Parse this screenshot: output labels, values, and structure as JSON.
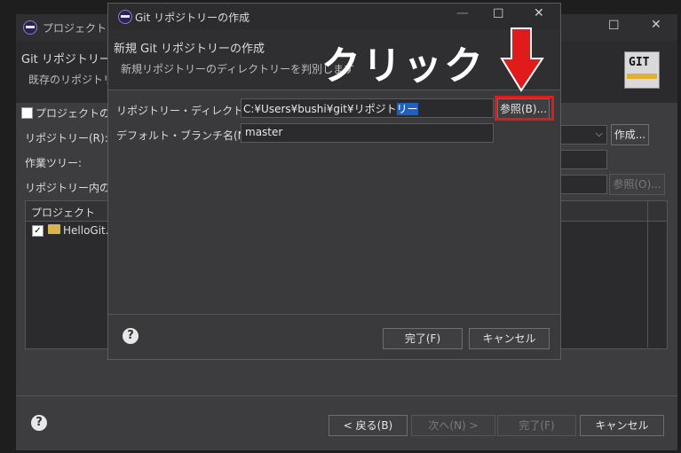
{
  "background_window": {
    "title": "プロジェクトの共",
    "page_title": "Git リポジトリーの",
    "page_subtitle": "既存のリポジトリー",
    "use_parent_checkbox_label": "プロジェクトの親フ",
    "repository_label": "リポジトリー(R):",
    "create_button": "作成...",
    "working_tree_label": "作業ツリー:",
    "path_in_repo_label": "リポジトリー内のパス",
    "browse_button": "参照(O)...",
    "table_header_project": "プロジェクト",
    "project_row": "HelloGit...",
    "back_button": "< 戻る(B)",
    "next_button": "次へ(N) >",
    "finish_button": "完了(F)",
    "cancel_button": "キャンセル"
  },
  "dialog": {
    "title": "Git リポジトリーの作成",
    "header_title": "新規 Git リポジトリーの作成",
    "header_subtitle": "新規リポジトリーのディレクトリーを判別します",
    "repo_dir_label": "リポジトリー・ディレクトリー(D):",
    "repo_dir_value_plain": "C:¥Users¥bushi¥git¥リポジト",
    "repo_dir_value_selected": "リー",
    "browse_button": "参照(B)...",
    "default_branch_label": "デフォルト・ブランチ名(N):",
    "default_branch_value": "master",
    "finish_button": "完了(F)",
    "cancel_button": "キャンセル"
  },
  "annotation": {
    "text": "クリック",
    "arrow_color": "#e11b1b",
    "highlight_color": "#e11b1b"
  },
  "icons": {
    "git_logo_text": "GIT",
    "help_glyph": "?"
  }
}
